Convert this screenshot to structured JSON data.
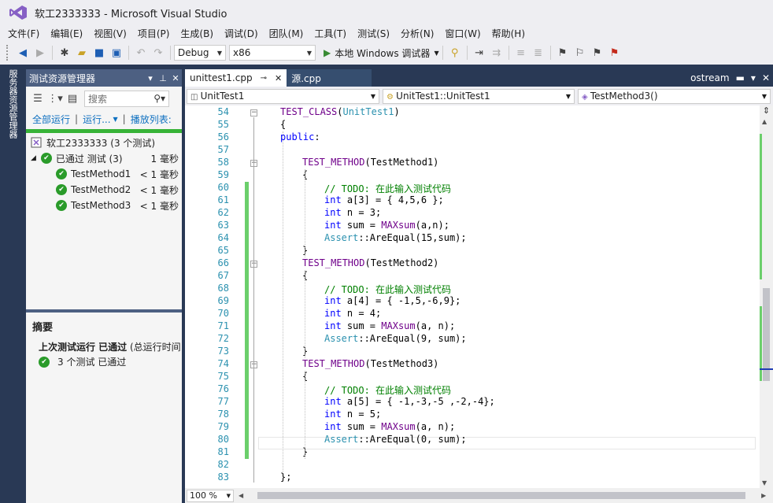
{
  "window": {
    "title": "软工2333333 - Microsoft Visual Studio"
  },
  "menu": [
    "文件(F)",
    "编辑(E)",
    "视图(V)",
    "项目(P)",
    "生成(B)",
    "调试(D)",
    "团队(M)",
    "工具(T)",
    "测试(S)",
    "分析(N)",
    "窗口(W)",
    "帮助(H)"
  ],
  "toolbar": {
    "config": "Debug",
    "platform": "x86",
    "run_label": "本地 Windows 调试器"
  },
  "side_strip": {
    "label": "服务器资源管理器"
  },
  "test_explorer": {
    "title": "测试资源管理器",
    "search_placeholder": "搜索",
    "links": {
      "run_all": "全部运行",
      "run": "运行...",
      "playlist": "播放列表:"
    },
    "solution": "软工2333333 (3 个测试)",
    "group": {
      "label": "已通过 测试 (3)",
      "duration": "1 毫秒"
    },
    "tests": [
      {
        "name": "TestMethod1",
        "duration": "< 1 毫秒"
      },
      {
        "name": "TestMethod2",
        "duration": "< 1 毫秒"
      },
      {
        "name": "TestMethod3",
        "duration": "< 1 毫秒"
      }
    ],
    "summary": {
      "heading": "摘要",
      "last_run_bold": "上次测试运行 已通过",
      "last_run_rest": " (总运行时间",
      "passed": "3 个测试 已通过"
    }
  },
  "editor": {
    "tabs": [
      {
        "label": "unittest1.cpp",
        "pin": "⊸",
        "close": "✕"
      },
      {
        "label": "源.cpp"
      }
    ],
    "right_label": "ostream",
    "nav": {
      "project": "UnitTest1",
      "class": "UnitTest1::UnitTest1",
      "member": "TestMethod3()"
    },
    "zoom": "100 %",
    "line_numbers": [
      "54",
      "55",
      "56",
      "57",
      "58",
      "59",
      "60",
      "61",
      "62",
      "63",
      "64",
      "65",
      "66",
      "67",
      "68",
      "69",
      "70",
      "71",
      "72",
      "73",
      "74",
      "75",
      "76",
      "77",
      "78",
      "79",
      "80",
      "81",
      "82",
      "83"
    ],
    "code": [
      "TEST_CLASS(UnitTest1)",
      "{",
      "public:",
      "",
      "TEST_METHOD(TestMethod1)",
      "{",
      "// TODO: 在此输入测试代码",
      "int a[3] = { 4,5,6 };",
      "int n = 3;",
      "int sum = MAXsum(a,n);",
      "Assert::AreEqual(15,sum);",
      "}",
      "TEST_METHOD(TestMethod2)",
      "{",
      "// TODO: 在此输入测试代码",
      "int a[4] = { -1,5,-6,9};",
      "int n = 4;",
      "int sum = MAXsum(a, n);",
      "Assert::AreEqual(9, sum);",
      "}",
      "TEST_METHOD(TestMethod3)",
      "{",
      "// TODO: 在此输入测试代码",
      "int a[5] = { -1,-3,-5 ,-2,-4};",
      "int n = 5;",
      "int sum = MAXsum(a, n);",
      "Assert::AreEqual(0, sum);",
      "}",
      "",
      "};"
    ]
  },
  "colors": {
    "accent": "#293955",
    "pass": "#2a9b2a",
    "keyword": "#0000ff",
    "comment": "#008000",
    "macro": "#6f008a",
    "linenum": "#2b91af"
  }
}
